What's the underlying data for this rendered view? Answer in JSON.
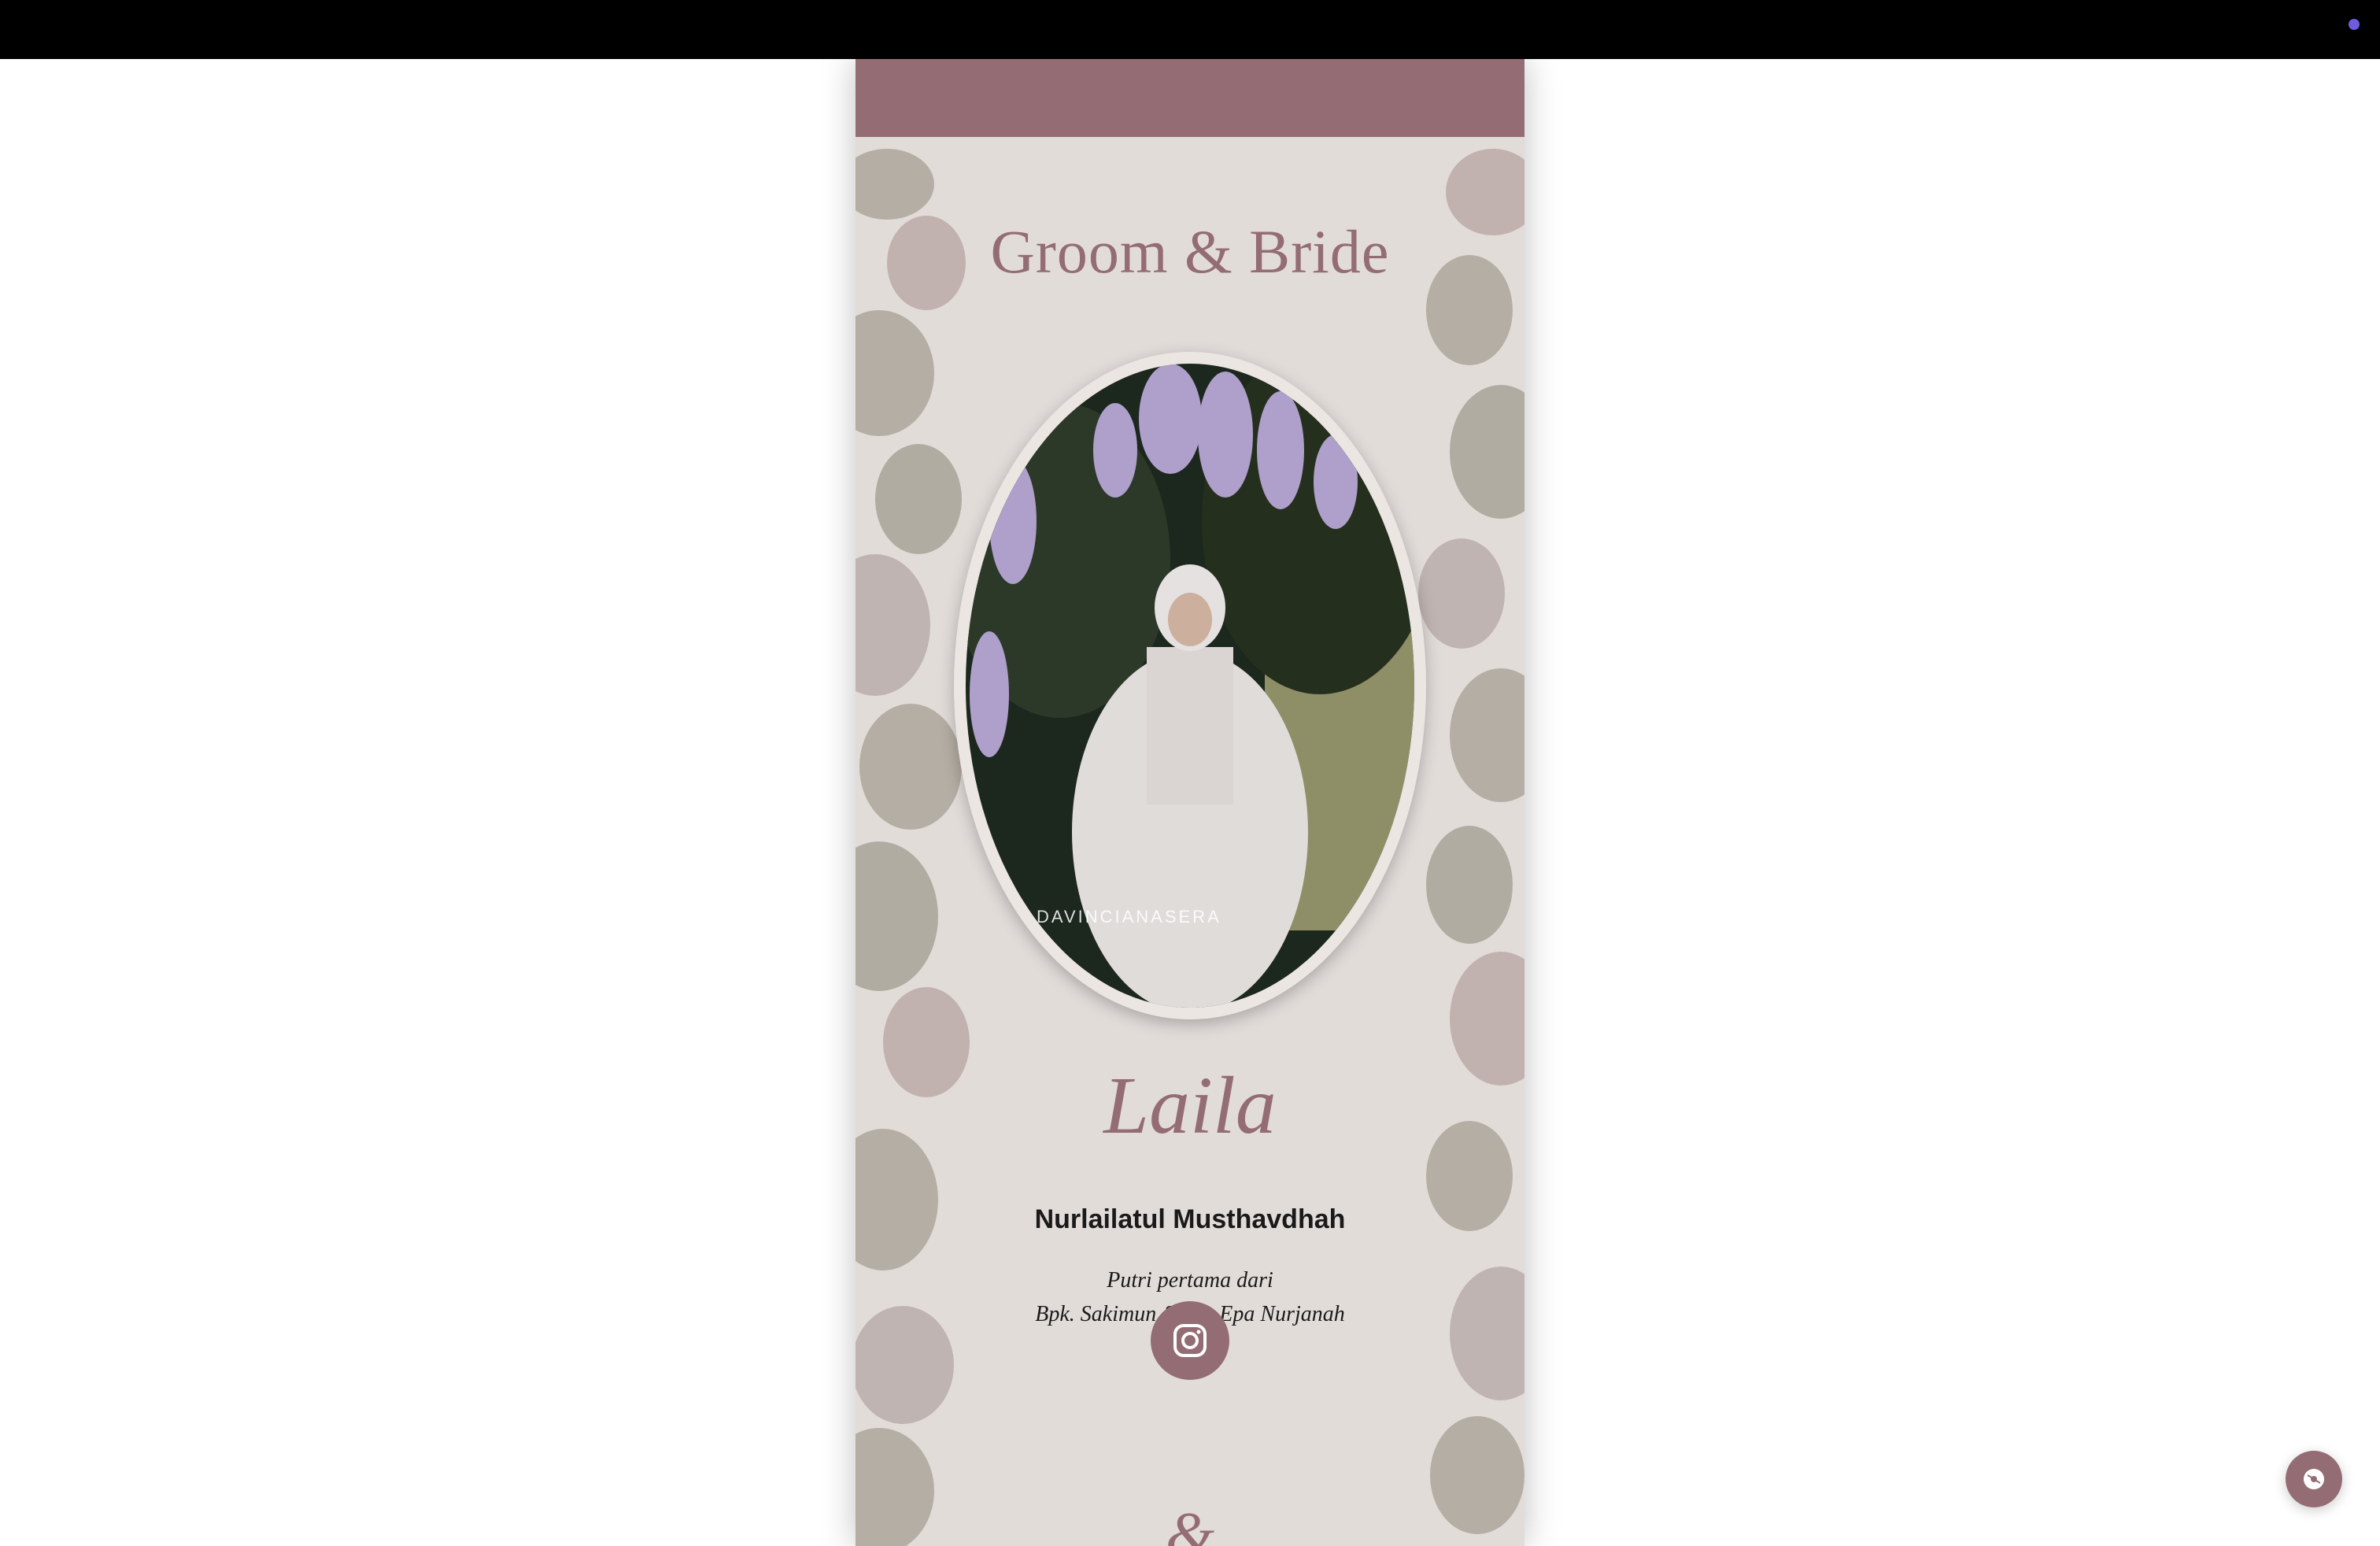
{
  "section": {
    "title": "Groom & Bride"
  },
  "photo": {
    "watermark": "DAVINCIANASERA"
  },
  "bride": {
    "nickname": "Laila",
    "full_name": "Nurlailatul Musthavdhah",
    "parents_line1": "Putri pertama dari",
    "parents_line2": "Bpk. Sakimun & Ibu Epa Nurjanah"
  },
  "next_section_glyph": "&",
  "icons": {
    "instagram": "instagram-icon",
    "music": "music-disc-icon"
  },
  "colors": {
    "accent": "#946d74",
    "background": "#e2dcd9",
    "topbar": "#000000"
  }
}
